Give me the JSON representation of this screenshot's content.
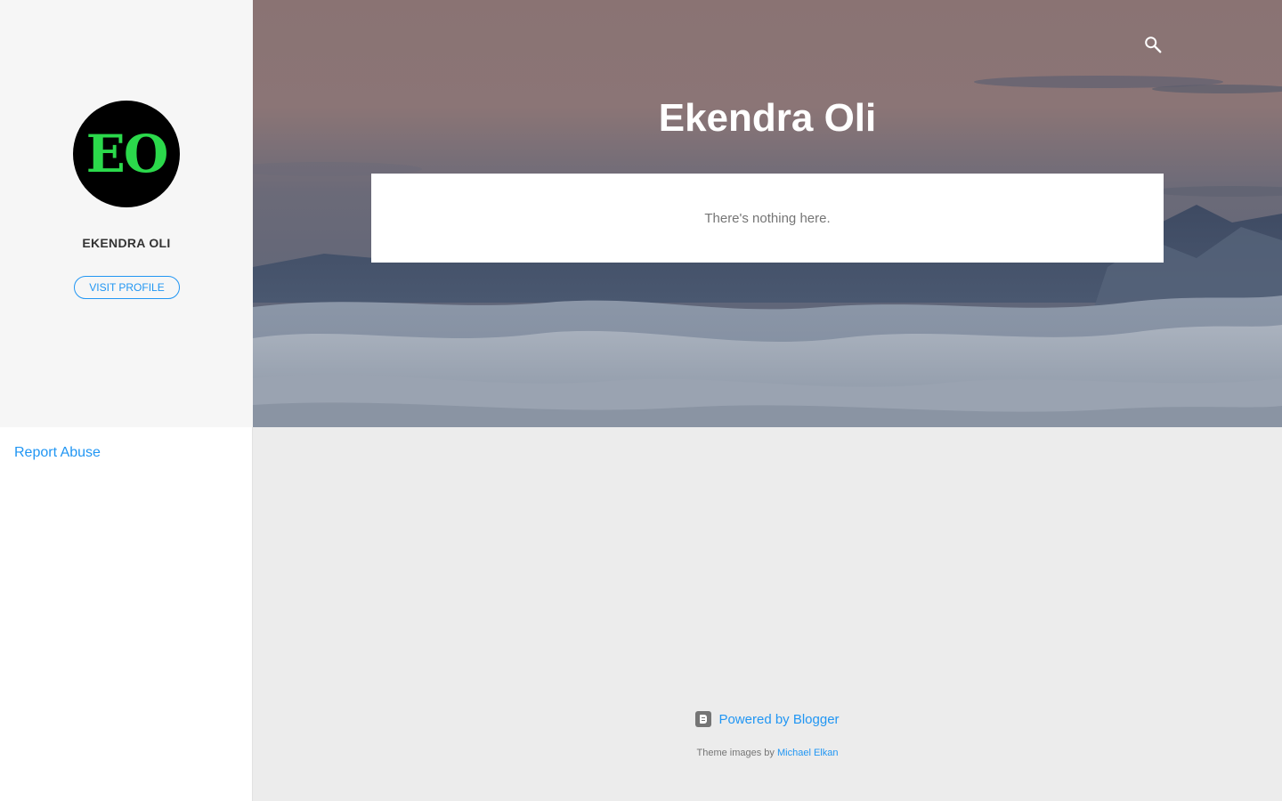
{
  "sidebar": {
    "avatar_text": "EO",
    "profile_name": "EKENDRA OLI",
    "visit_profile_label": "VISIT PROFILE",
    "report_abuse_label": "Report Abuse"
  },
  "header": {
    "title": "Ekendra Oli",
    "search_icon": "search-icon"
  },
  "main": {
    "empty_message": "There's nothing here."
  },
  "footer": {
    "powered_by_label": "Powered by Blogger",
    "theme_images_prefix": "Theme images by",
    "theme_images_author": "Michael Elkan"
  },
  "colors": {
    "accent": "#2196f3",
    "sidebar_bg": "#f6f6f6",
    "page_bg": "#ececec",
    "avatar_bg": "#000000",
    "avatar_text": "#2bd94b"
  }
}
